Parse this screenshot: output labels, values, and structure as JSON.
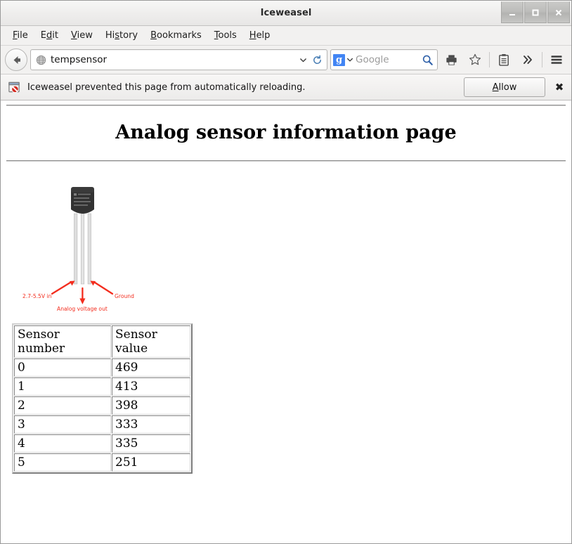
{
  "window": {
    "title": "Iceweasel",
    "controls": [
      {
        "name": "minimize",
        "glyph": "_"
      },
      {
        "name": "maximize",
        "glyph": "□"
      },
      {
        "name": "close",
        "glyph": "×"
      }
    ]
  },
  "menubar": {
    "items": [
      {
        "label": "File",
        "accesskey": "F"
      },
      {
        "label": "Edit",
        "accesskey": "E"
      },
      {
        "label": "View",
        "accesskey": "V"
      },
      {
        "label": "History",
        "accesskey": "s"
      },
      {
        "label": "Bookmarks",
        "accesskey": "B"
      },
      {
        "label": "Tools",
        "accesskey": "T"
      },
      {
        "label": "Help",
        "accesskey": "H"
      }
    ]
  },
  "navbar": {
    "back_icon": "back-arrow-icon",
    "favicon": "globe-icon",
    "url_value": "tempsensor",
    "url_dropdown_icon": "chevron-down-icon",
    "reload_icon": "reload-icon",
    "search": {
      "engine": "Google",
      "engine_logo_letter": "g",
      "placeholder": "Google",
      "value": "",
      "engine_dropdown_icon": "chevron-down-icon",
      "go_icon": "magnifier-icon"
    },
    "buttons": [
      {
        "name": "print-button",
        "icon": "printer-icon"
      },
      {
        "name": "bookmark-button",
        "icon": "star-icon"
      },
      {
        "name": "reader-button",
        "icon": "clipboard-icon"
      },
      {
        "name": "overflow-button",
        "icon": "double-chevron-right-icon"
      },
      {
        "name": "menu-button",
        "icon": "hamburger-icon"
      }
    ]
  },
  "notification": {
    "icon": "blocked-page-icon",
    "message": "Iceweasel prevented this page from automatically reloading.",
    "allow_label": "Allow",
    "allow_accesskey": "A",
    "close_label": "✖"
  },
  "page": {
    "title": "Analog sensor information page",
    "figure": {
      "name": "temperature-sensor-diagram",
      "alt": "TO-92 analog temperature sensor pinout",
      "chip_body_color": "#2f2f2f",
      "lead_color": "#d8d8d8",
      "annotation_color": "#f32d1e",
      "labels": [
        {
          "text": "2.7-5.5V in",
          "pin": "left"
        },
        {
          "text": "Analog voltage out",
          "pin": "middle"
        },
        {
          "text": "Ground",
          "pin": "right"
        }
      ]
    },
    "table": {
      "headers": [
        "Sensor number",
        "Sensor value"
      ],
      "rows": [
        [
          "0",
          "469"
        ],
        [
          "1",
          "413"
        ],
        [
          "2",
          "398"
        ],
        [
          "3",
          "333"
        ],
        [
          "4",
          "335"
        ],
        [
          "5",
          "251"
        ]
      ]
    }
  }
}
